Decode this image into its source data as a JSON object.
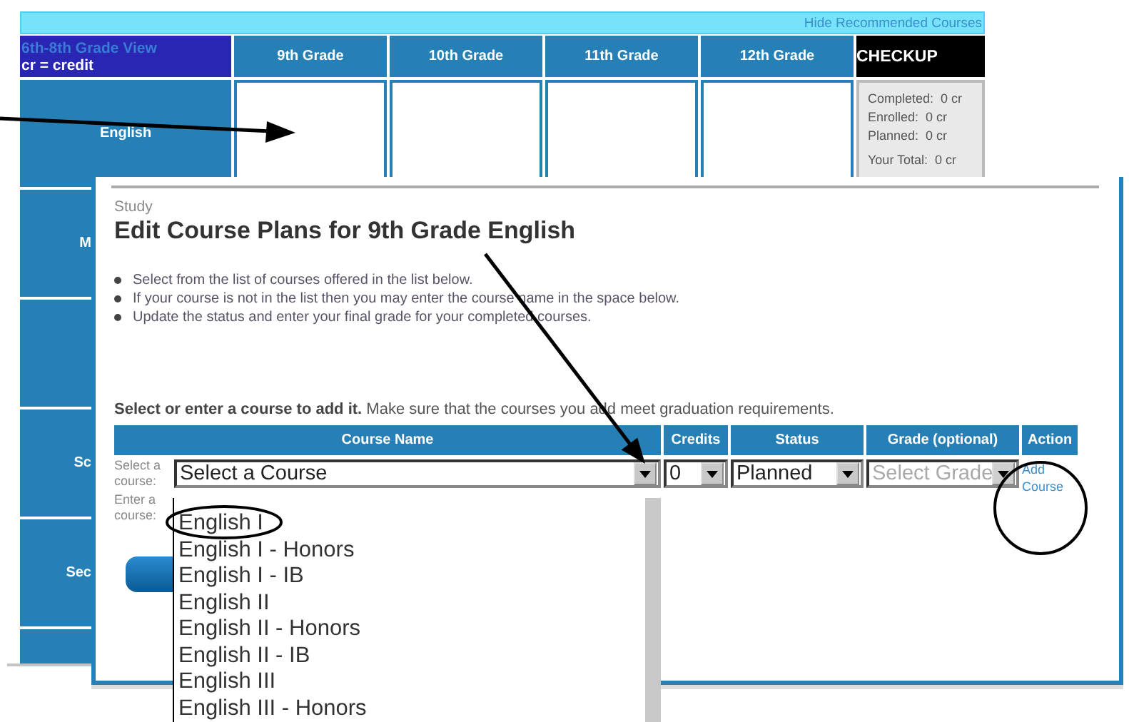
{
  "top_bar": {
    "link": "Hide Recommended Courses"
  },
  "grid": {
    "corner": {
      "title": "6th-8th Grade View",
      "note": "cr = credit"
    },
    "columns": [
      "9th Grade",
      "10th Grade",
      "11th Grade",
      "12th Grade"
    ],
    "checkup": {
      "title": "CHECKUP",
      "lines": [
        {
          "label": "Completed:",
          "value": "0 cr"
        },
        {
          "label": "Enrolled:",
          "value": "0 cr"
        },
        {
          "label": "Planned:",
          "value": "0 cr"
        },
        {
          "label": "Your Total:",
          "value": "0 cr"
        }
      ]
    },
    "rows": [
      {
        "kind": "label",
        "subject": "English",
        "clipped": false
      },
      {
        "kind": "label",
        "subject": "M",
        "clipped": true
      },
      {
        "kind": "blank"
      },
      {
        "kind": "label",
        "subject": "Sc",
        "clipped": true
      },
      {
        "kind": "label",
        "subject": "Sec",
        "clipped": true
      },
      {
        "kind": "blank"
      }
    ]
  },
  "dialog": {
    "breadcrumb": "Study",
    "title": "Edit Course Plans for 9th Grade English",
    "instructions": [
      "Select from the list of courses offered in the list below.",
      "If your course is not in the list then you may enter the course name in the space below.",
      "Update the status and enter your final grade for your completed courses."
    ],
    "prompt": "**Select or enter a course to add it.** Make sure that the courses you add meet graduation requirements.",
    "table": {
      "columns": [
        "Course Name",
        "Credits",
        "Status",
        "Grade (optional)",
        "Action"
      ],
      "select_label": "Select a course:",
      "enter_label": "Enter a course:",
      "course": {
        "value": "Select a Course"
      },
      "credits": {
        "value": "0"
      },
      "status": {
        "value": "Planned"
      },
      "grade": {
        "placeholder": "Select Grade",
        "disabled": true
      },
      "action": "Add Course"
    },
    "dropdown": {
      "options": [
        {
          "label": "English I",
          "selected": false
        },
        {
          "label": "English I - Honors",
          "selected": false
        },
        {
          "label": "English I - IB",
          "selected": false
        },
        {
          "label": "English II",
          "selected": false
        },
        {
          "label": "English II - Honors",
          "selected": false
        },
        {
          "label": "English II - IB",
          "selected": false
        },
        {
          "label": "English III",
          "selected": false
        },
        {
          "label": "English III - Honors",
          "selected": false
        }
      ]
    }
  }
}
